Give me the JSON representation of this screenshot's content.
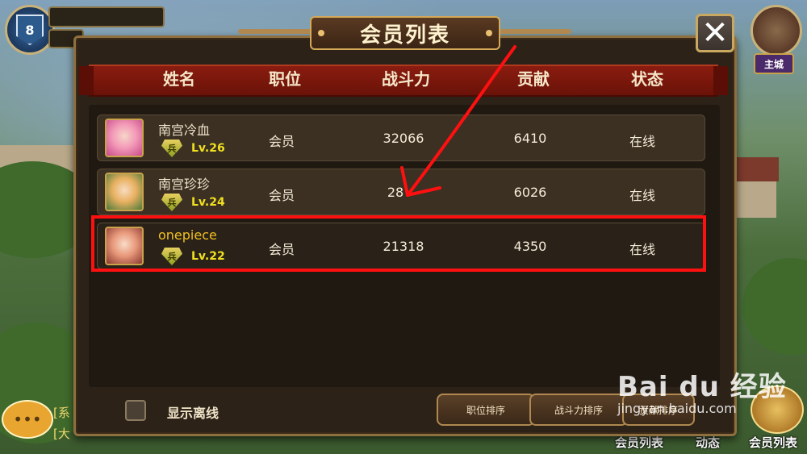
{
  "hud": {
    "player_level": "8",
    "castle_label": "主城",
    "chat_lines": [
      "[系",
      "[大"
    ],
    "bottom_buttons": [
      "会员列表",
      "动态",
      "会员列表"
    ]
  },
  "dialog": {
    "title": "会员列表",
    "close_label": "✕",
    "columns": [
      "姓名",
      "职位",
      "战斗力",
      "贡献",
      "状态"
    ],
    "members": [
      {
        "name": "南宫冷血",
        "level": "Lv.26",
        "position": "会员",
        "power": "32066",
        "contribution": "6410",
        "status": "在线",
        "rank_glyph": "兵"
      },
      {
        "name": "南宫珍珍",
        "level": "Lv.24",
        "position": "会员",
        "power": "28",
        "contribution": "6026",
        "status": "在线",
        "rank_glyph": "兵"
      },
      {
        "name": "onepiece",
        "level": "Lv.22",
        "position": "会员",
        "power": "21318",
        "contribution": "4350",
        "status": "在线",
        "rank_glyph": "兵"
      }
    ],
    "show_offline_label": "显示离线",
    "sort_buttons": [
      "职位排序",
      "战斗力排序",
      "贡献排序"
    ]
  },
  "watermark": {
    "brand": "Bai du 经验",
    "url": "jingyan.baidu.com"
  },
  "colors": {
    "highlight": "#ff1010",
    "annotation_arrow": "#ff1010",
    "self_name": "#f0c020"
  }
}
